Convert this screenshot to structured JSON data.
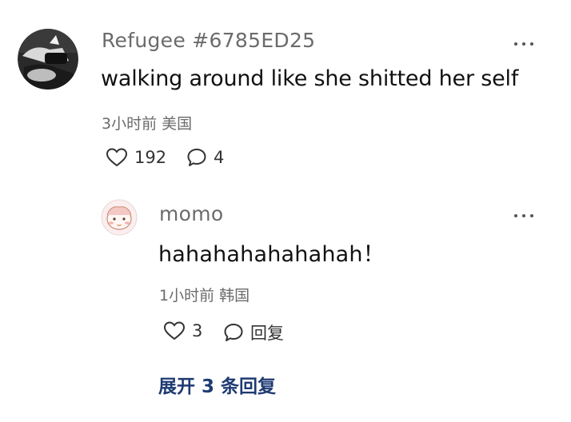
{
  "comment": {
    "username": "Refugee #6785ED25",
    "text": "walking around like she shitted her self",
    "meta": "3小时前 美国",
    "likes": "192",
    "replies": "4"
  },
  "reply": {
    "username": "momo",
    "text": "hahahahahahahah！",
    "meta": "1小时前 韩国",
    "likes": "3",
    "reply_label": "回复"
  },
  "expand_label": "展开 3 条回复",
  "icons": {
    "more": "more-icon",
    "like": "heart-icon",
    "comment": "comment-bubble-icon"
  },
  "colors": {
    "username": "#6b6b6b",
    "text": "#111111",
    "meta": "#6b6b6b",
    "expand_link": "#1e3a72"
  }
}
